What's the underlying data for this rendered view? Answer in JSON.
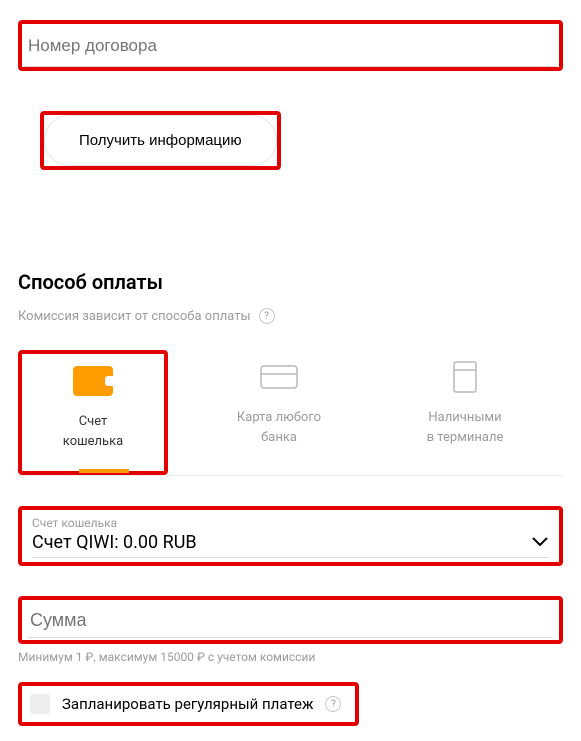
{
  "contract": {
    "placeholder": "Номер договора"
  },
  "getInfo": {
    "label": "Получить информацию"
  },
  "payment": {
    "title": "Способ оплаты",
    "commission_text": "Комиссия зависит от способа оплаты",
    "help": "?",
    "methods": {
      "wallet": "Счет\nкошелька",
      "card": "Карта любого\nбанка",
      "cash": "Наличными\nв терминале"
    }
  },
  "account": {
    "label": "Счет кошелька",
    "value": "Счет QIWI: 0.00 RUB"
  },
  "amount": {
    "placeholder": "Сумма",
    "hint": "Минимум 1 ₽, максимум 15000 ₽ с учетом комиссии"
  },
  "schedule": {
    "label": "Запланировать регулярный платеж",
    "help": "?"
  }
}
